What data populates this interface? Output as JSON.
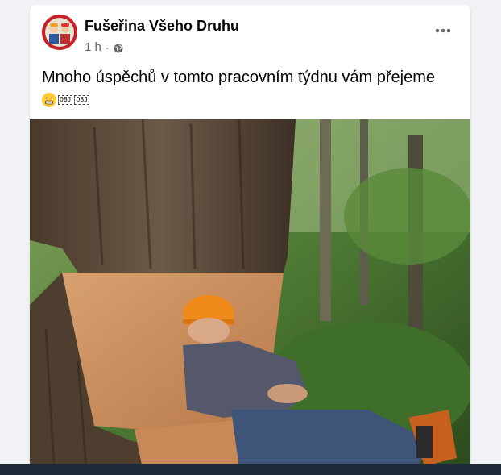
{
  "post": {
    "page_name": "Fušeřina Všeho Druhu",
    "timestamp": "1 h",
    "separator": "·",
    "caption": "Mnoho úspěchů v tomto pracovním týdnu vám přejeme",
    "emoji_tags": [
      "OBJ",
      "OBJ"
    ],
    "more_icon": "more-horizontal-icon",
    "privacy_icon": "globe-icon"
  },
  "colors": {
    "background": "#f0f2f5",
    "card": "#ffffff",
    "name_text": "#050505",
    "meta_text": "#65676b",
    "avatar_bg": "#c8202a",
    "hardhat": "#f08a1a"
  }
}
